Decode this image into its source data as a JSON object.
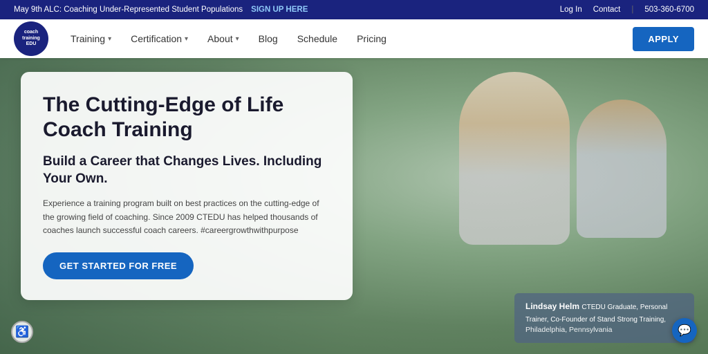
{
  "topbar": {
    "announcement": "May 9th ALC: Coaching Under-Represented Student Populations",
    "signup_label": "SIGN UP HERE",
    "login_label": "Log In",
    "contact_label": "Contact",
    "phone": "503-360-6700"
  },
  "navbar": {
    "logo_line1": "coach",
    "logo_line2": "training",
    "logo_line3": "EDU",
    "training_label": "Training",
    "certification_label": "Certification",
    "about_label": "About",
    "blog_label": "Blog",
    "schedule_label": "Schedule",
    "pricing_label": "Pricing",
    "apply_label": "APPLY"
  },
  "hero": {
    "title": "The Cutting-Edge of Life Coach Training",
    "subtitle": "Build a Career that Changes Lives. Including Your Own.",
    "description": "Experience a training program built on best practices on the cutting-edge of the growing field of coaching. Since 2009 CTEDU has helped thousands of coaches launch successful coach careers. #careergrowthwithpurpose",
    "cta_label": "GET STARTED FOR FREE",
    "caption_name": "Lindsay Helm",
    "caption_role": "CTEDU Graduate, Personal Trainer, Co-Founder of Stand Strong Training,",
    "caption_location": "Philadelphia, Pennsylvania"
  },
  "icons": {
    "chevron": "▾",
    "accessibility": "♿",
    "chat": "💬"
  }
}
